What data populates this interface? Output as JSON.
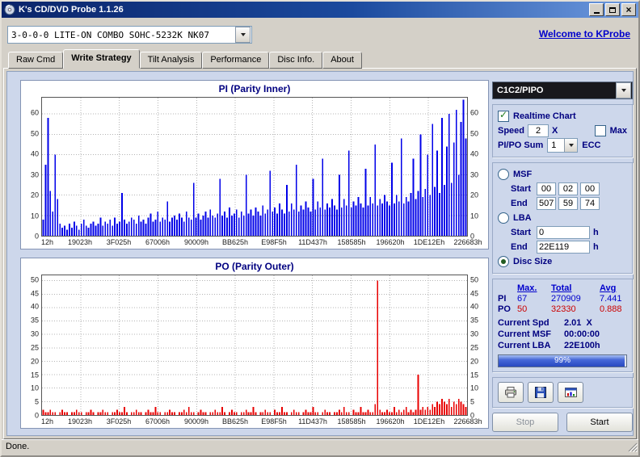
{
  "window": {
    "title": "K's CD/DVD Probe 1.1.26"
  },
  "toolbar": {
    "device": "3-0-0-0 LITE-ON COMBO SOHC-5232K NK07",
    "link": "Welcome to KProbe"
  },
  "tabs": [
    "Raw Cmd",
    "Write Strategy",
    "Tilt Analysis",
    "Performance",
    "Disc Info.",
    "About"
  ],
  "active_tab": "Write Strategy",
  "chart_data": {
    "xlabels": [
      "12h",
      "19023h",
      "3F025h",
      "67006h",
      "90009h",
      "BB625h",
      "E98F5h",
      "11D437h",
      "158585h",
      "196620h",
      "1DE12Eh",
      "226683h"
    ],
    "pi": {
      "type": "bar",
      "title": "PI (Parity Inner)",
      "color": "#0000e8",
      "yticks": [
        0,
        10,
        20,
        30,
        40,
        50,
        60
      ],
      "scale_max": 68,
      "values": [
        8,
        35,
        58,
        22,
        12,
        40,
        18,
        6,
        4,
        5,
        3,
        6,
        4,
        7,
        5,
        3,
        6,
        8,
        5,
        4,
        6,
        7,
        5,
        6,
        9,
        5,
        7,
        6,
        8,
        5,
        9,
        6,
        7,
        21,
        8,
        6,
        7,
        9,
        8,
        6,
        10,
        7,
        8,
        6,
        9,
        11,
        7,
        8,
        12,
        7,
        9,
        8,
        17,
        7,
        9,
        10,
        8,
        11,
        9,
        7,
        12,
        9,
        8,
        26,
        9,
        11,
        8,
        10,
        12,
        9,
        13,
        10,
        9,
        11,
        28,
        10,
        12,
        9,
        14,
        10,
        11,
        13,
        9,
        12,
        10,
        30,
        11,
        13,
        10,
        14,
        12,
        10,
        15,
        11,
        13,
        32,
        12,
        14,
        11,
        16,
        13,
        11,
        25,
        12,
        16,
        13,
        35,
        12,
        15,
        13,
        17,
        14,
        12,
        28,
        13,
        17,
        14,
        38,
        13,
        16,
        14,
        18,
        15,
        13,
        30,
        14,
        18,
        15,
        42,
        14,
        17,
        15,
        19,
        16,
        14,
        33,
        15,
        19,
        16,
        45,
        15,
        18,
        16,
        20,
        17,
        15,
        36,
        16,
        20,
        17,
        48,
        16,
        19,
        17,
        21,
        38,
        18,
        22,
        50,
        19,
        23,
        40,
        20,
        55,
        24,
        42,
        21,
        58,
        25,
        44,
        60,
        26,
        46,
        62,
        30,
        56,
        67,
        48
      ]
    },
    "po": {
      "type": "bar",
      "title": "PO (Parity Outer)",
      "color": "#e80000",
      "yticks": [
        0,
        5,
        10,
        15,
        20,
        25,
        30,
        35,
        40,
        45,
        50
      ],
      "scale_max": 52,
      "values": [
        2,
        1,
        1,
        2,
        1,
        1,
        0,
        1,
        2,
        1,
        1,
        0,
        1,
        1,
        2,
        1,
        1,
        0,
        1,
        1,
        2,
        1,
        0,
        1,
        1,
        2,
        1,
        1,
        0,
        1,
        1,
        2,
        1,
        1,
        3,
        1,
        0,
        1,
        1,
        2,
        1,
        1,
        0,
        1,
        2,
        1,
        1,
        3,
        1,
        1,
        0,
        1,
        1,
        2,
        1,
        1,
        0,
        1,
        1,
        2,
        1,
        3,
        1,
        1,
        0,
        1,
        2,
        1,
        1,
        0,
        1,
        1,
        2,
        1,
        1,
        3,
        1,
        0,
        1,
        2,
        1,
        1,
        0,
        1,
        1,
        2,
        1,
        1,
        3,
        1,
        0,
        1,
        1,
        2,
        1,
        1,
        0,
        2,
        1,
        1,
        3,
        1,
        1,
        0,
        1,
        2,
        1,
        1,
        0,
        1,
        2,
        1,
        1,
        3,
        1,
        1,
        0,
        1,
        2,
        1,
        1,
        0,
        1,
        1,
        2,
        1,
        3,
        1,
        1,
        0,
        2,
        1,
        1,
        3,
        1,
        1,
        2,
        1,
        1,
        4,
        50,
        2,
        1,
        1,
        2,
        1,
        1,
        3,
        1,
        2,
        1,
        2,
        3,
        1,
        2,
        1,
        2,
        15,
        2,
        3,
        2,
        3,
        2,
        4,
        3,
        5,
        4,
        6,
        5,
        4,
        6,
        3,
        5,
        4,
        6,
        5,
        4,
        3
      ]
    }
  },
  "panel": {
    "mode": "C1C2/PIPO",
    "realtime_label": "Realtime Chart",
    "speed_label": "Speed",
    "speed_value": "2",
    "speed_unit": "X",
    "max_label": "Max",
    "sum_label": "PI/PO Sum",
    "sum_value": "1",
    "sum_unit": "ECC",
    "msf": {
      "label": "MSF",
      "start_label": "Start",
      "end_label": "End",
      "start": [
        "00",
        "02",
        "00"
      ],
      "end": [
        "507",
        "59",
        "74"
      ]
    },
    "lba": {
      "label": "LBA",
      "start_label": "Start",
      "end_label": "End",
      "start": "0",
      "end": "22E119",
      "unit": "h"
    },
    "disc_size_label": "Disc Size",
    "stats": {
      "headers": [
        "Max.",
        "Total",
        "Avg"
      ],
      "rows": [
        {
          "name": "PI",
          "max": "67",
          "total": "270909",
          "avg": "7.441"
        },
        {
          "name": "PO",
          "max": "50",
          "total": "32330",
          "avg": "0.888"
        }
      ]
    },
    "current": [
      {
        "label": "Current Spd",
        "value": "2.01  X"
      },
      {
        "label": "Current MSF",
        "value": "00:00:00"
      },
      {
        "label": "Current LBA",
        "value": "22E100h"
      }
    ],
    "progress": {
      "percent": 99,
      "label": "99%"
    },
    "buttons": {
      "stop": "Stop",
      "start": "Start"
    }
  },
  "statusbar": {
    "text": "Done."
  }
}
